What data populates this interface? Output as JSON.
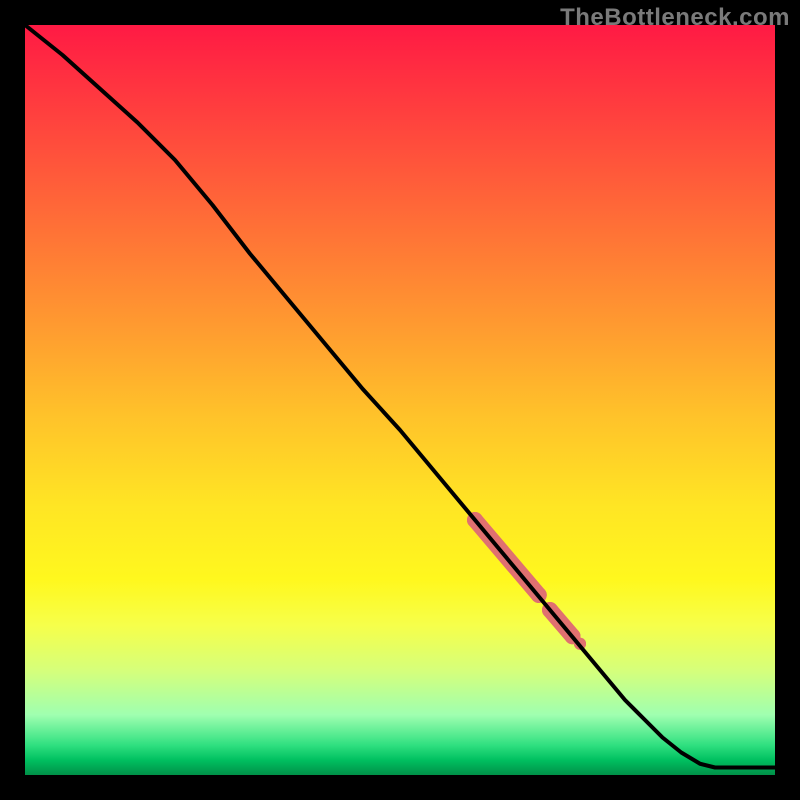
{
  "watermark": "TheBottleneck.com",
  "colors": {
    "curve": "#000000",
    "marker": "#e07070",
    "marker_stroke": "#d85a5a"
  },
  "chart_data": {
    "type": "line",
    "title": "",
    "xlabel": "",
    "ylabel": "",
    "xlim": [
      0,
      100
    ],
    "ylim": [
      0,
      100
    ],
    "grid": false,
    "legend": false,
    "curve": {
      "name": "bottleneck-curve",
      "x": [
        0,
        5,
        10,
        15,
        20,
        25,
        30,
        35,
        40,
        45,
        50,
        55,
        60,
        62.5,
        65,
        67.5,
        70,
        72.5,
        75,
        77.5,
        80,
        82.5,
        85,
        87.5,
        90,
        92,
        94,
        100
      ],
      "y": [
        100,
        96,
        91.5,
        87,
        82,
        76,
        69.5,
        63.5,
        57.5,
        51.5,
        46,
        40,
        34,
        31,
        28,
        25,
        22,
        19,
        16,
        13,
        10,
        7.5,
        5,
        3,
        1.5,
        1,
        1,
        1
      ]
    },
    "markers": {
      "name": "highlighted-range",
      "segments": [
        {
          "x": [
            60,
            68.5
          ],
          "y": [
            34,
            24
          ],
          "thickness": 16
        },
        {
          "x": [
            70,
            73
          ],
          "y": [
            22,
            18.5
          ],
          "thickness": 16
        },
        {
          "x": [
            74,
            74
          ],
          "y": [
            17.5,
            17.5
          ],
          "thickness": 12
        }
      ]
    }
  }
}
